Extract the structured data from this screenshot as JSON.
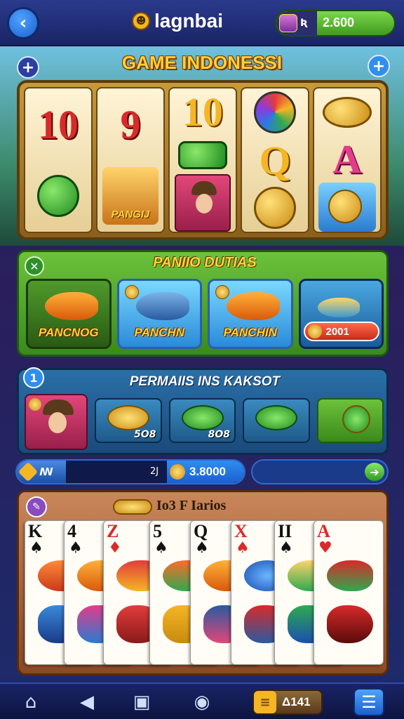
{
  "header": {
    "back_icon": "‹",
    "brand_icon": "☻",
    "brand_title": "lagnbai",
    "currency_symbol": "Ʀ",
    "currency_value": "2.600"
  },
  "slot": {
    "title": "GAME INDONESSI",
    "plus_left": "+",
    "plus_right": "+",
    "reels": [
      {
        "top": "10",
        "bottom_type": "green-coin"
      },
      {
        "top": "9",
        "bottom_label": "PANGIJ"
      },
      {
        "top": "10",
        "middle_type": "gem",
        "bottom_type": "person"
      },
      {
        "top_type": "multi-coin",
        "middle": "Q",
        "bottom_type": "gold-coin"
      },
      {
        "top_type": "coins",
        "middle": "A",
        "bottom_type": "pile"
      }
    ]
  },
  "fishing_panel": {
    "close": "✕",
    "title": "PANIIO DUTIAS",
    "cards": [
      {
        "label": "PANCNOG"
      },
      {
        "label": "PANCHN"
      },
      {
        "label": "PANCHIN"
      },
      {
        "price": "2001"
      }
    ]
  },
  "reward_panel": {
    "badge": "1",
    "title": "PERMAIIS INS KAKSOT",
    "tiles": [
      {
        "label": "5O8"
      },
      {
        "label": "8O8"
      },
      {
        "label": ""
      },
      {
        "label": ""
      }
    ]
  },
  "bars": {
    "chip_label": "ꟿ",
    "small_value": "2J",
    "main_value": "3.8000",
    "arrow": "➔"
  },
  "cards_panel": {
    "edit_icon": "✎",
    "title": "Io3 F Iarios",
    "cards": [
      {
        "rank": "K",
        "suit": "♠",
        "color": "black"
      },
      {
        "rank": "4",
        "suit": "♠",
        "color": "black"
      },
      {
        "rank": "Z",
        "suit": "♦",
        "color": "red"
      },
      {
        "rank": "5",
        "suit": "♠",
        "color": "black"
      },
      {
        "rank": "Q",
        "suit": "♠",
        "color": "black"
      },
      {
        "rank": "X",
        "suit": "♠",
        "color": "red"
      },
      {
        "rank": "II",
        "suit": "♠",
        "color": "black"
      },
      {
        "rank": "A",
        "suit": "♥",
        "color": "red"
      }
    ]
  },
  "bottom_nav": {
    "home_icon": "⌂",
    "back_icon": "◀",
    "grid_icon": "▣",
    "circle_icon": "◉",
    "pill_icon": "≡",
    "pill_value": "Δ141",
    "menu_icon": "☰"
  },
  "colors": {
    "accent_gold": "#ffd23a",
    "bg": "#1d2a6e",
    "green": "#6cc23a"
  }
}
